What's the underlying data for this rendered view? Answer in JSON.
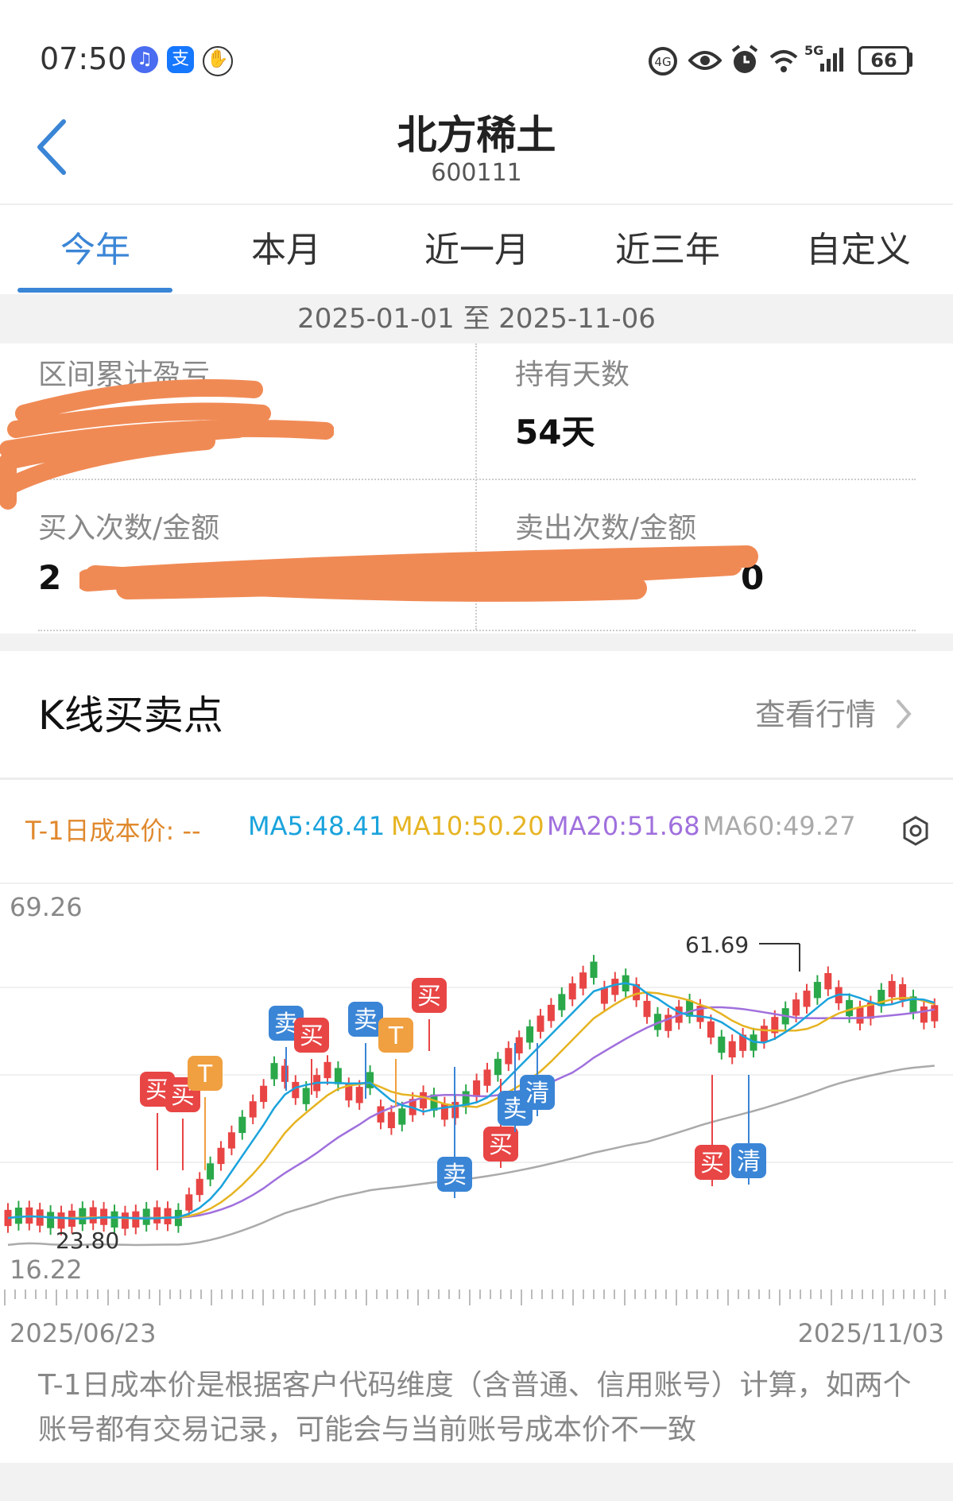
{
  "status_bar": {
    "time": "07:50",
    "network": "5G",
    "battery": "66",
    "icons": [
      "music-icon",
      "alipay-icon",
      "hand-icon",
      "data-saver-icon",
      "eye-icon",
      "alarm-icon",
      "wifi-icon",
      "signal-icon",
      "battery-icon"
    ]
  },
  "header": {
    "title": "北方稀土",
    "code": "600111",
    "back_icon": "chevron-left-icon"
  },
  "tabs": [
    {
      "label": "今年",
      "active": true
    },
    {
      "label": "本月",
      "active": false
    },
    {
      "label": "近一月",
      "active": false
    },
    {
      "label": "近三年",
      "active": false
    },
    {
      "label": "自定义",
      "active": false
    }
  ],
  "date_range": "2025-01-01 至 2025-11-06",
  "stats": {
    "cumulative_pnl_label": "区间累计盈亏",
    "holding_days_label": "持有天数",
    "holding_days_value": "54天",
    "buy_label": "买入次数/金额",
    "buy_value_visible": "2",
    "sell_label": "卖出次数/金额",
    "sell_value_visible": "0"
  },
  "kline": {
    "title": "K线买卖点",
    "view_link": "查看行情",
    "legend": {
      "cost": "T-1日成本价: --",
      "ma5": "MA5:48.41",
      "ma10": "MA10:50.20",
      "ma20": "MA20:51.68",
      "ma60": "MA60:49.27"
    },
    "colors": {
      "cost": "#e0892e",
      "ma5": "#1aa3dc",
      "ma10": "#e6b422",
      "ma20": "#a070dd",
      "ma60": "#aaaaaa",
      "up": "#e84545",
      "down": "#2aa84a",
      "buy_marker": "#e84545",
      "sell_marker": "#3a85d6",
      "t_marker": "#f0a040"
    },
    "y_max_label": "69.26",
    "y_min_label": "16.22",
    "peak_label": "61.69",
    "low_label": "23.80",
    "x_start_label": "2025/06/23",
    "x_end_label": "2025/11/03",
    "markers": {
      "buy": "买",
      "sell": "卖",
      "clear": "清",
      "t": "T"
    }
  },
  "footer_note": "T-1日成本价是根据客户代码维度（含普通、信用账号）计算，如两个账号都有交易记录，可能会与当前账号成本价不一致"
}
